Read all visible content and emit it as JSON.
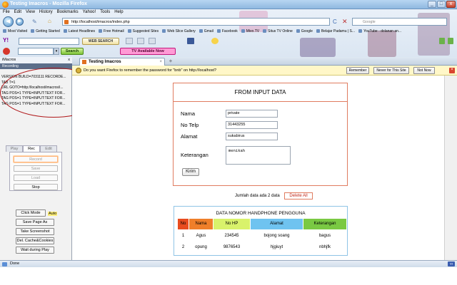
{
  "window": {
    "title": "Testing Imacros - Mozilla Firefox"
  },
  "menubar": [
    "File",
    "Edit",
    "View",
    "History",
    "Bookmarks",
    "Yahoo!",
    "Tools",
    "Help"
  ],
  "navbar": {
    "url": "http://localhost/imacros/index.php",
    "search_placeholder": "Google"
  },
  "bookmarks": [
    "Most Visited",
    "Getting Started",
    "Latest Headlines",
    "Free Hotmail",
    "Suggested Sites",
    "Web Slice Gallery",
    "Gmail",
    "Facebook",
    "Mivo.TV",
    "Situs TV Online",
    "Google",
    "Belajar Padamu | S...",
    "YouTube - dolanan an..."
  ],
  "yahoo_toolbar": {
    "brand": "Y!",
    "web_search": "WEB SEARCH"
  },
  "toolbar3": {
    "search_button": "Search",
    "tv_button": "TV Available Now"
  },
  "sidebar": {
    "title": "iMacros",
    "close": "x",
    "status": "Recording",
    "macro_lines": [
      "VERSION BUILD=7031111 RECORDE...",
      "TAB T=1",
      "URL GOTO=http://localhost/imacros/i...",
      "TAG POS=1 TYPE=INPUT:TEXT FOR...",
      "TAG POS=1 TYPE=INPUT:TEXT FOR...",
      "TAG POS=1 TYPE=INPUT:TEXT FOR..."
    ],
    "tabs": [
      "Play",
      "Rec",
      "Edit"
    ],
    "rec_buttons": {
      "record": "Record",
      "save": "Save",
      "load": "Load",
      "stop": "Stop"
    },
    "action_buttons": {
      "click_mode": "Click Mode",
      "save_page": "Save Page As",
      "screenshot": "Take Screenshot",
      "clear": "Del. Cache&Cookies",
      "wait": "Wait during Play"
    },
    "auto_label": "Auto"
  },
  "tab": {
    "title": "Testing Imacros"
  },
  "notification": {
    "message": "Do you want Firefox to remember the password for \"bnb\" on http://localhost?",
    "remember": "Remember",
    "never": "Never for This Site",
    "not_now": "Not Now"
  },
  "form": {
    "header": "FROM INPUT DATA",
    "nama_label": "Nama",
    "nama_value": "private",
    "telp_label": "No Telp",
    "telp_value": "31443255",
    "alamat_label": "Alamat",
    "alamat_value": "sukabirus",
    "ket_label": "Keterangan",
    "ket_value": "menikah",
    "submit": "Kirim"
  },
  "summary": {
    "count_text": "Jumlah data ada 2 data",
    "delete_all": "Delete All"
  },
  "table": {
    "title": "DATA NOMOR HANDPHONE PENGGUNA",
    "headers": [
      "No",
      "Nama",
      "No HP",
      "Alamat",
      "Keterangan"
    ],
    "header_colors": [
      "#e84c1f",
      "#ef7f2a",
      "#d9f26b",
      "#6fc3f0",
      "#7ac943"
    ],
    "rows": [
      [
        "1",
        "Agus",
        "234545",
        "bojong soang",
        "bagus"
      ],
      [
        "2",
        "opung",
        "9876543",
        "hjgiuyt",
        "nbhjfk"
      ]
    ]
  },
  "statusbar": {
    "text": "Done"
  }
}
